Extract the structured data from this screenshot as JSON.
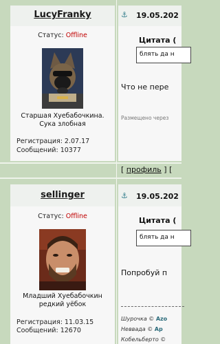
{
  "posts": [
    {
      "username": "LucyFranky",
      "status_label": "Статус:",
      "status_value": "Offline",
      "caption_line1": "Старшая Хуебабочкина.",
      "caption_line2": "Сука злобная",
      "reg": "Регистрация: 2.07.17",
      "msgs": "Сообщений: 10377",
      "date": "19.05.202",
      "quote_label": "Цитата (",
      "quote_text": "блять да н",
      "post_text": "Что не пере",
      "meta": "Размещено через",
      "links": {
        "open": "[",
        "profile": "профиль",
        "close": "] ["
      }
    },
    {
      "username": "sellinger",
      "status_label": "Статус:",
      "status_value": "Offline",
      "caption_line1": "Младший Хуебабочкин",
      "caption_line2": "редкий уёбок",
      "reg": "Регистрация: 11.03.15",
      "msgs": "Сообщений: 12670",
      "date": "19.05.202",
      "quote_label": "Цитата (",
      "quote_text": "блять да н",
      "post_text": "Попробуй п",
      "signature": [
        {
          "name": "Шурочка",
          "sep": "©",
          "who": "Azo"
        },
        {
          "name": "Неввада",
          "sep": "©",
          "who": "Ар"
        },
        {
          "name": "Кобельберто",
          "sep": "©",
          "who": ""
        }
      ]
    }
  ],
  "icons": {
    "anchor": "⚓"
  }
}
